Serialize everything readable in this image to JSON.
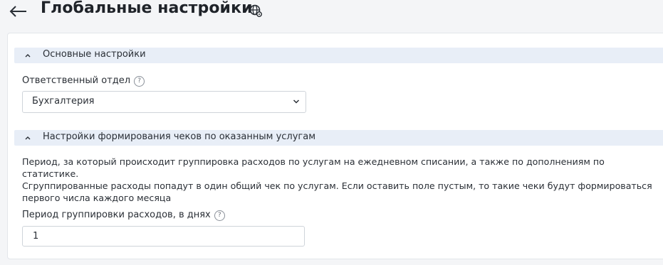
{
  "header": {
    "title": "Глобальные настройки",
    "back_icon": "arrow-left-icon",
    "globe_icon": "globe-gear-icon"
  },
  "sections": {
    "basic": {
      "title": "Основные настройки",
      "department_label": "Ответственный отдел",
      "department_value": "Бухгалтерия"
    },
    "receipts": {
      "title": "Настройки формирования чеков по оказанным услугам",
      "description_lines": [
        "Период, за который происходит группировка расходов по услугам на ежедневном списании, а также по дополнениям по статистике.",
        "Сгруппированные расходы попадут в один общий чек по услугам. Если оставить поле пустым, то такие чеки будут формироваться",
        "первого числа каждого месяца"
      ],
      "period_label": "Период группировки расходов, в днях",
      "period_value": "1"
    }
  },
  "help_glyph": "?",
  "colors": {
    "page_bg": "#f4f5f7",
    "section_bar": "#e8eef7",
    "text": "#2a2f36",
    "border": "#cfd4da"
  }
}
